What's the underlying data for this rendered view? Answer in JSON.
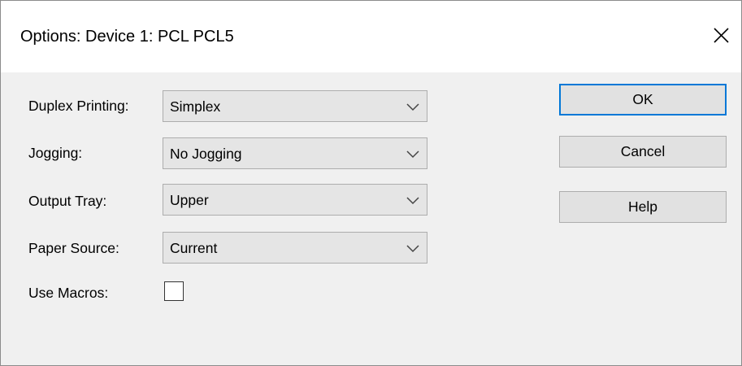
{
  "window": {
    "title": "Options: Device 1: PCL PCL5"
  },
  "fields": {
    "duplex": {
      "label": "Duplex Printing:",
      "value": "Simplex"
    },
    "jogging": {
      "label": "Jogging:",
      "value": "No Jogging"
    },
    "output_tray": {
      "label": "Output Tray:",
      "value": "Upper"
    },
    "paper_source": {
      "label": "Paper Source:",
      "value": "Current"
    },
    "use_macros": {
      "label": "Use Macros:",
      "checked": false
    }
  },
  "buttons": {
    "ok": "OK",
    "cancel": "Cancel",
    "help": "Help"
  },
  "icons": {
    "close": "close-icon",
    "dropdown": "chevron-down-icon"
  },
  "colors": {
    "accent": "#0078d7",
    "dialog_background": "#f0f0f0",
    "titlebar_background": "#ffffff"
  }
}
